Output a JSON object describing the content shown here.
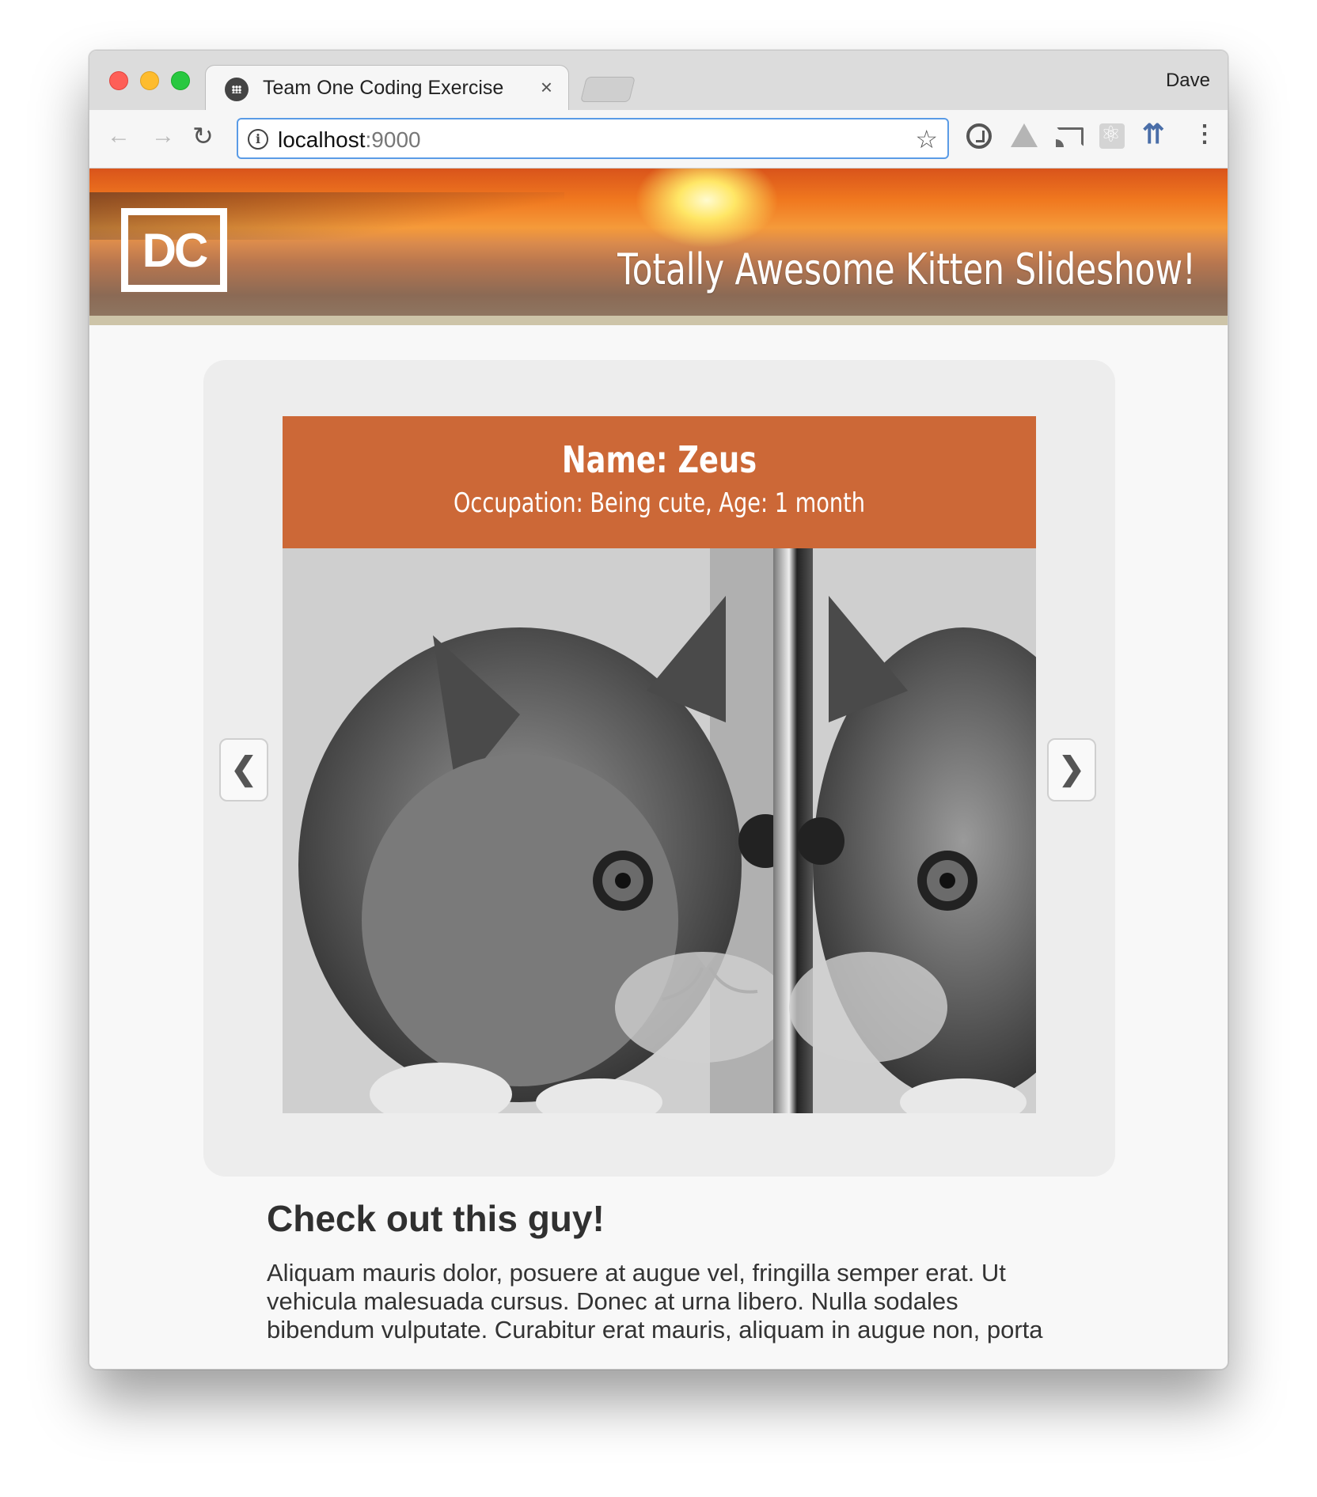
{
  "browser": {
    "tab_title": "Team One Coding Exercise",
    "tab_close": "×",
    "profile_name": "Dave",
    "url_host": "localhost",
    "url_port": ":9000"
  },
  "icons": {
    "back": "back-arrow-icon",
    "forward": "forward-arrow-icon",
    "reload": "reload-icon",
    "info": "info-icon",
    "bookmark": "star-icon",
    "menu": "more-vertical-icon"
  },
  "banner": {
    "logo_text": "DC",
    "title": "Totally Awesome Kitten Slideshow!"
  },
  "slide": {
    "name": "Name: Zeus",
    "meta": "Occupation: Being cute, Age: 1 month",
    "prev_symbol": "❮",
    "next_symbol": "❯"
  },
  "content": {
    "heading": "Check out this guy!",
    "paragraph": "Aliquam mauris dolor, posuere at augue vel, fringilla semper erat. Ut vehicula malesuada cursus. Donec at urna libero. Nulla sodales bibendum vulputate. Curabitur erat mauris, aliquam in augue non, porta"
  },
  "colors": {
    "caption_bg": "#cc6837",
    "panel_bg": "#ededed",
    "omnibox_focus": "#5a9be6"
  }
}
